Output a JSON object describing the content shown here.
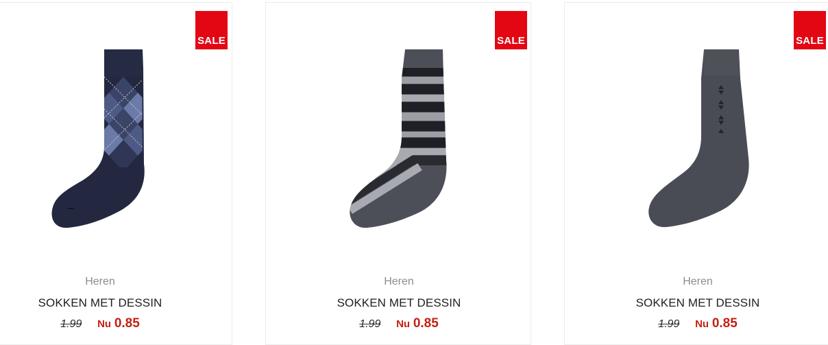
{
  "products": [
    {
      "badge": "SALE",
      "category": "Heren",
      "title": "SOKKEN MET DESSIN",
      "old_price": "1.99",
      "now_label": "Nu",
      "now_price": "0.85",
      "image_alt": "navy argyle sock"
    },
    {
      "badge": "SALE",
      "category": "Heren",
      "title": "SOKKEN MET DESSIN",
      "old_price": "1.99",
      "now_label": "Nu",
      "now_price": "0.85",
      "image_alt": "grey striped sock"
    },
    {
      "badge": "SALE",
      "category": "Heren",
      "title": "SOKKEN MET DESSIN",
      "old_price": "1.99",
      "now_label": "Nu",
      "now_price": "0.85",
      "image_alt": "grey sock with small motif"
    }
  ],
  "colors": {
    "sale_badge": "#e30613",
    "price_red": "#c41f12",
    "category_grey": "#8c8c8c",
    "title": "#1e1e1e"
  }
}
